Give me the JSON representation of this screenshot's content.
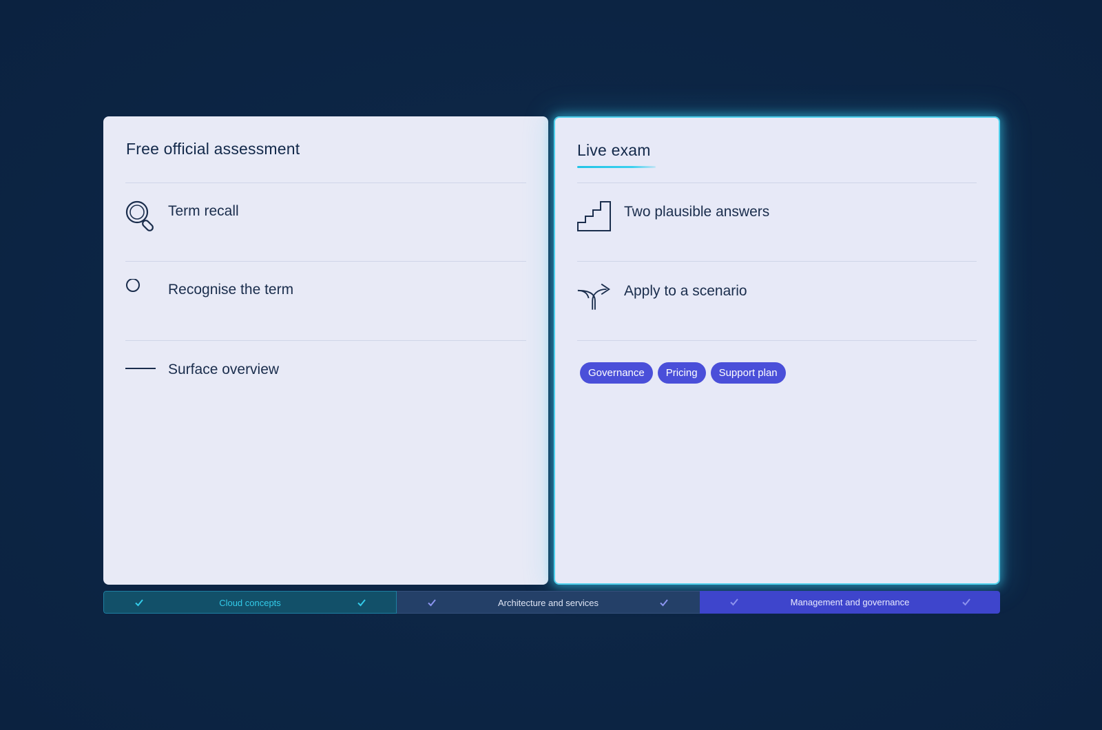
{
  "left_card": {
    "title": "Free official assessment",
    "items": [
      {
        "label": "Term recall",
        "icon": "magnifier-icon"
      },
      {
        "label": "Recognise the term",
        "icon": "circle-icon"
      },
      {
        "label": "Surface overview",
        "icon": "line-icon"
      }
    ]
  },
  "right_card": {
    "title": "Live exam",
    "items": [
      {
        "label": "Two plausible answers",
        "icon": "stairs-icon"
      },
      {
        "label": "Apply to a scenario",
        "icon": "fork-arrow-icon"
      }
    ],
    "tags": [
      "Governance",
      "Pricing",
      "Support plan"
    ]
  },
  "domain_bar": {
    "segments": [
      {
        "label": "Cloud concepts",
        "state": "active",
        "color": "#33cbe9"
      },
      {
        "label": "Architecture and services",
        "state": "default",
        "color": "#244068"
      },
      {
        "label": "Management and governance",
        "state": "highlight",
        "color": "#3e45cc"
      }
    ]
  },
  "colors": {
    "background": "#0d2645",
    "card": "#e8eaf6",
    "accent_cyan": "#22c3e6",
    "chip": "#4a4fd9",
    "text": "#13294a"
  }
}
